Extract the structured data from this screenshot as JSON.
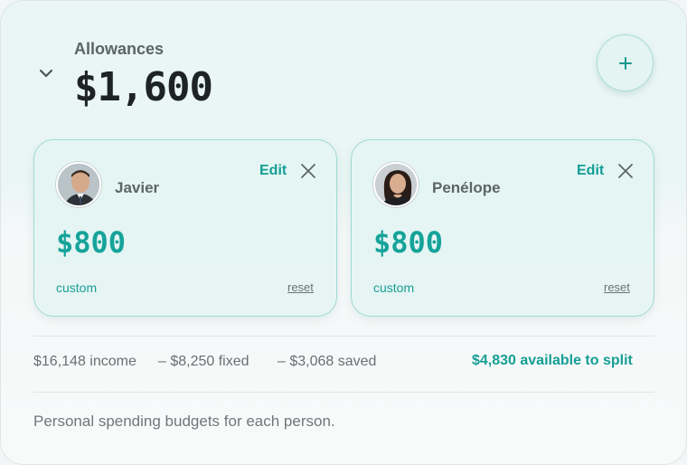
{
  "header": {
    "title": "Allowances",
    "total": "$1,600",
    "collapse_icon": "chevron-down-icon",
    "add_icon": "plus-icon"
  },
  "people": [
    {
      "name": "Javier",
      "edit_label": "Edit",
      "amount": "$800",
      "mode": "custom",
      "reset_label": "reset"
    },
    {
      "name": "Penélope",
      "edit_label": "Edit",
      "amount": "$800",
      "mode": "custom",
      "reset_label": "reset"
    }
  ],
  "summary": {
    "income": "$16,148 income",
    "fixed": "– $8,250 fixed",
    "saved": "– $3,068 saved",
    "available": "$4,830 available to split"
  },
  "footnote": "Personal spending budgets for each person.",
  "colors": {
    "accent": "#159e96",
    "card_border": "#9fd9d3",
    "title_text": "#1e2426"
  }
}
